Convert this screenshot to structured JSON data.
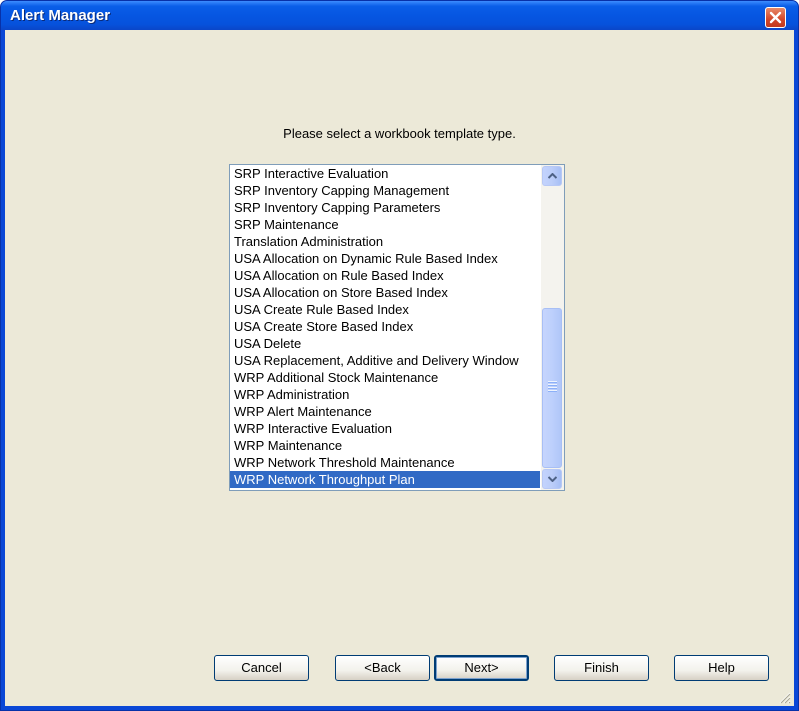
{
  "window": {
    "title": "Alert Manager"
  },
  "prompt": "Please select a workbook template type.",
  "list": {
    "items": [
      "SRP Interactive Evaluation",
      "SRP Inventory Capping Management",
      "SRP Inventory Capping Parameters",
      "SRP Maintenance",
      "Translation Administration",
      "USA Allocation on Dynamic Rule Based Index",
      "USA Allocation on Rule Based Index",
      "USA Allocation on Store Based Index",
      "USA Create Rule Based Index",
      "USA Create Store Based Index",
      "USA Delete",
      "USA Replacement, Additive and Delivery Window",
      "WRP Additional Stock Maintenance",
      "WRP Administration",
      "WRP Alert Maintenance",
      "WRP Interactive Evaluation",
      "WRP Maintenance",
      "WRP Network Threshold Maintenance",
      "WRP Network Throughput Plan"
    ],
    "selected_item": "WRP Network Throughput Plan"
  },
  "buttons": {
    "cancel": "Cancel",
    "back": "<Back",
    "next": "Next>",
    "finish": "Finish",
    "help": "Help"
  },
  "icons": {
    "close": "close-icon",
    "scroll_up": "scroll-up-arrow-icon",
    "scroll_down": "scroll-down-arrow-icon",
    "resize": "resize-grip-icon"
  },
  "colors": {
    "titlebar": "#0656e2",
    "client_background": "#ece9d8",
    "selection": "#316ac5",
    "close_button": "#d2472a"
  }
}
